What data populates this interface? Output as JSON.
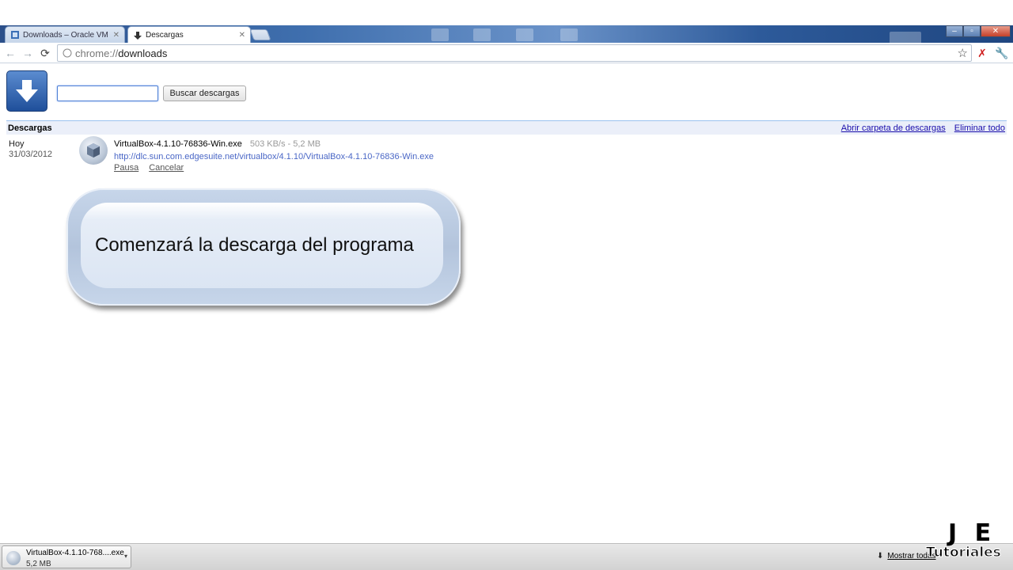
{
  "browser": {
    "tabs": [
      {
        "label": "Downloads – Oracle VM Vir",
        "active": false
      },
      {
        "label": "Descargas",
        "active": true
      }
    ],
    "address": {
      "scheme": "chrome://",
      "path": "downloads"
    }
  },
  "downloads_page": {
    "search_placeholder": "",
    "search_button": "Buscar descargas",
    "section_title": "Descargas",
    "open_folder_link": "Abrir carpeta de descargas",
    "clear_all_link": "Eliminar todo",
    "entries": [
      {
        "day": "Hoy",
        "date": "31/03/2012",
        "file_name": "VirtualBox-4.1.10-76836-Win.exe",
        "progress": "503 KB/s - 5,2 MB",
        "url": "http://dlc.sun.com.edgesuite.net/virtualbox/4.1.10/VirtualBox-4.1.10-76836-Win.exe",
        "pause_label": "Pausa",
        "cancel_label": "Cancelar"
      }
    ]
  },
  "callout": {
    "text": "Comenzará la descarga del programa"
  },
  "shelf": {
    "item_name": "VirtualBox-4.1.10-768....exe",
    "item_size": "5,2 MB",
    "show_all": "Mostrar todas"
  },
  "watermark": {
    "line1": "J E",
    "line2": "Tutoriales"
  },
  "colors": {
    "link": "#1a0dab",
    "url": "#4a67c6",
    "section_bg": "#ebeff9",
    "logo_blue": "#2e64b5"
  }
}
